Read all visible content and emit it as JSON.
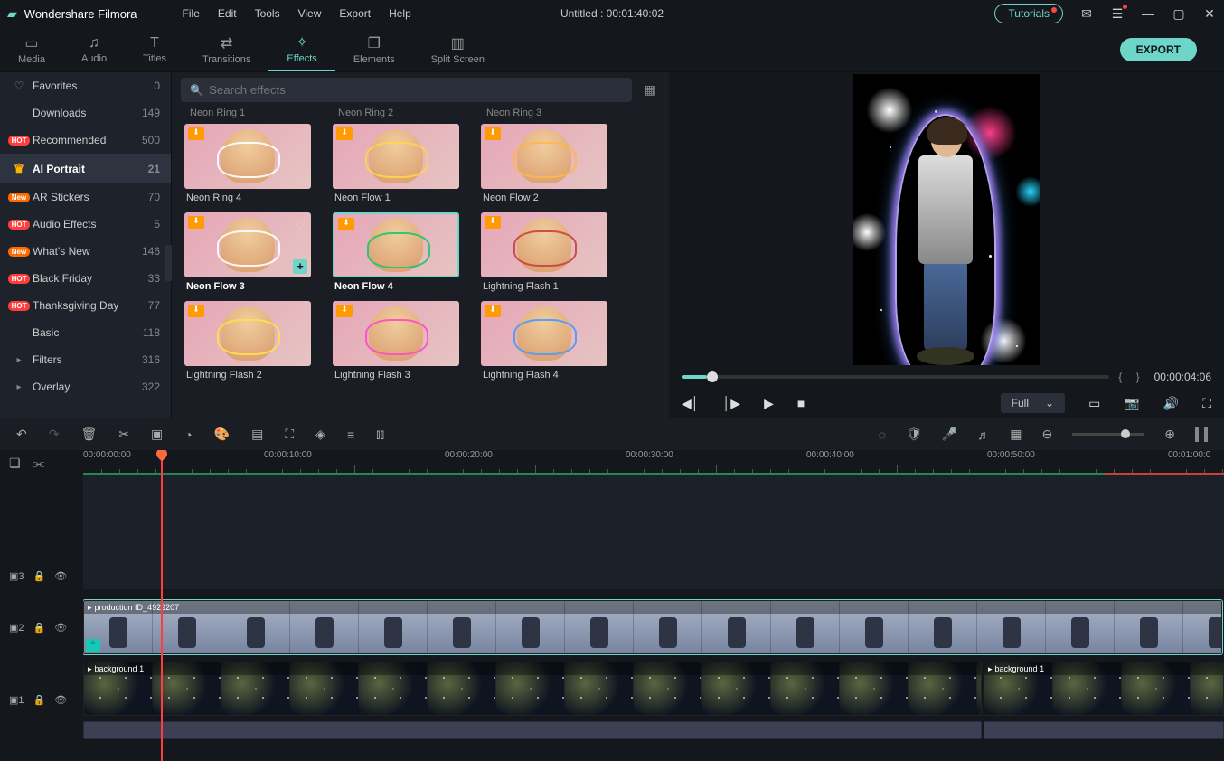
{
  "titlebar": {
    "app_name": "Wondershare Filmora",
    "menu": [
      "File",
      "Edit",
      "Tools",
      "View",
      "Export",
      "Help"
    ],
    "document": "Untitled : 00:01:40:02",
    "tutorials": "Tutorials"
  },
  "tabs": {
    "items": [
      {
        "icon": "▭",
        "label": "Media"
      },
      {
        "icon": "♫",
        "label": "Audio"
      },
      {
        "icon": "T",
        "label": "Titles"
      },
      {
        "icon": "⇄",
        "label": "Transitions"
      },
      {
        "icon": "✧",
        "label": "Effects"
      },
      {
        "icon": "❐",
        "label": "Elements"
      },
      {
        "icon": "▥",
        "label": "Split Screen"
      }
    ],
    "active": 4,
    "export": "EXPORT"
  },
  "sidebar": {
    "items": [
      {
        "icon_type": "heart",
        "icon": "♡",
        "label": "Favorites",
        "count": "0"
      },
      {
        "icon_type": "none",
        "icon": "",
        "label": "Downloads",
        "count": "149"
      },
      {
        "icon_type": "hot",
        "icon": "HOT",
        "label": "Recommended",
        "count": "500"
      },
      {
        "icon_type": "crown",
        "icon": "♛",
        "label": "AI Portrait",
        "count": "21"
      },
      {
        "icon_type": "new",
        "icon": "New",
        "label": "AR Stickers",
        "count": "70"
      },
      {
        "icon_type": "hot",
        "icon": "HOT",
        "label": "Audio Effects",
        "count": "5"
      },
      {
        "icon_type": "new",
        "icon": "New",
        "label": "What's New",
        "count": "146"
      },
      {
        "icon_type": "hot",
        "icon": "HOT",
        "label": "Black Friday",
        "count": "33"
      },
      {
        "icon_type": "hot",
        "icon": "HOT",
        "label": "Thanksgiving Day",
        "count": "77"
      },
      {
        "icon_type": "none",
        "icon": "",
        "label": "Basic",
        "count": "118"
      },
      {
        "icon_type": "caret",
        "icon": "▸",
        "label": "Filters",
        "count": "316"
      },
      {
        "icon_type": "caret",
        "icon": "▸",
        "label": "Overlay",
        "count": "322"
      }
    ],
    "active": 3
  },
  "search": {
    "placeholder": "Search effects"
  },
  "effects": {
    "cut_row": [
      "Neon Ring 1",
      "Neon Ring 2",
      "Neon Ring 3"
    ],
    "rows": [
      [
        {
          "label": "Neon Ring 4",
          "accent": "#fff"
        },
        {
          "label": "Neon Flow 1",
          "accent": "#ffd54a"
        },
        {
          "label": "Neon Flow 2",
          "accent": "#ffb74a"
        }
      ],
      [
        {
          "label": "Neon Flow 3",
          "accent": "#fff",
          "hover": true
        },
        {
          "label": "Neon Flow 4",
          "accent": "#19c76e",
          "selected": true
        },
        {
          "label": "Lightning Flash 1",
          "accent": "#c4443d"
        }
      ],
      [
        {
          "label": "Lightning Flash 2",
          "accent": "#ffe14a"
        },
        {
          "label": "Lightning Flash 3",
          "accent": "#ff4ac8"
        },
        {
          "label": "Lightning Flash 4",
          "accent": "#4a9aff"
        }
      ]
    ]
  },
  "preview": {
    "time": "00:00:04:06",
    "quality": "Full"
  },
  "ruler": {
    "marks": [
      "00:00:00:00",
      "00:00:10:00",
      "00:00:20:00",
      "00:00:30:00",
      "00:00:40:00",
      "00:00:50:00",
      "00:01:00:0"
    ]
  },
  "tracks": {
    "head3": "▣3",
    "head2": "▣2",
    "head1": "▣1",
    "clip2": "production ID_4929207",
    "clip1a": "background 1",
    "clip1b": "background 1"
  }
}
